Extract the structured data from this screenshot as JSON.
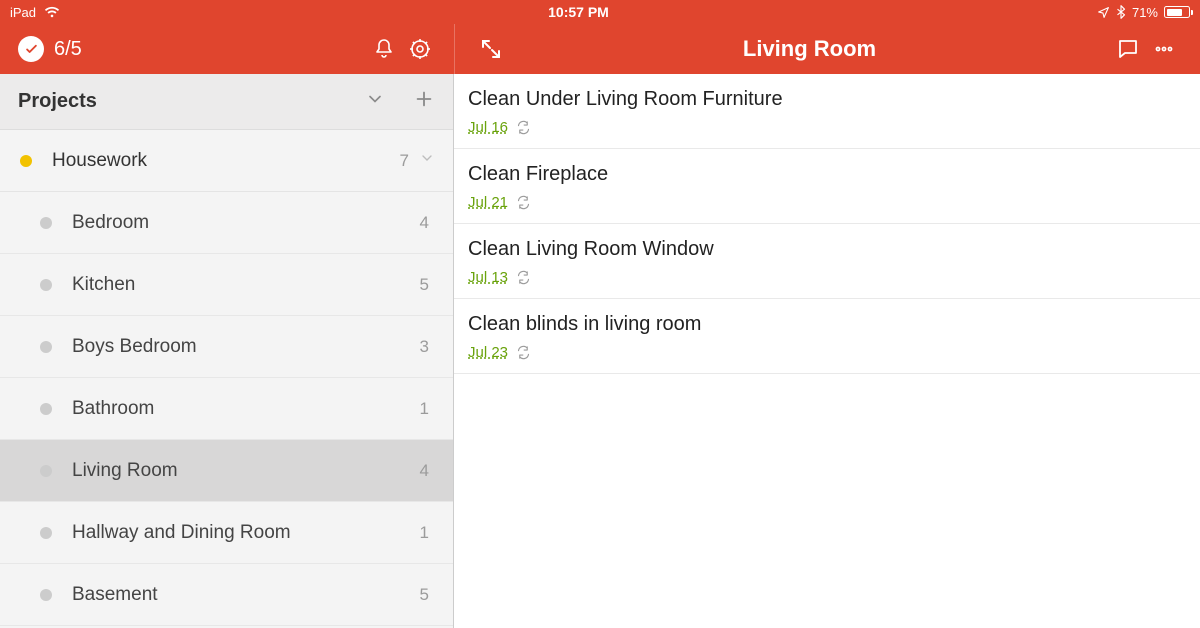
{
  "status": {
    "device": "iPad",
    "time": "10:57 PM",
    "battery_pct": "71%",
    "battery_level": 0.71
  },
  "appbar": {
    "date_label": "6/5",
    "content_title": "Living Room"
  },
  "sidebar": {
    "header": "Projects",
    "parent": {
      "name": "Housework",
      "count": "7"
    },
    "items": [
      {
        "name": "Bedroom",
        "count": "4"
      },
      {
        "name": "Kitchen",
        "count": "5"
      },
      {
        "name": "Boys Bedroom",
        "count": "3"
      },
      {
        "name": "Bathroom",
        "count": "1"
      },
      {
        "name": "Living Room",
        "count": "4"
      },
      {
        "name": "Hallway and Dining Room",
        "count": "1"
      },
      {
        "name": "Basement",
        "count": "5"
      }
    ],
    "selected_index": 4
  },
  "tasks": [
    {
      "title": "Clean Under Living Room Furniture",
      "date": "Jul 16"
    },
    {
      "title": "Clean Fireplace",
      "date": "Jul 21"
    },
    {
      "title": "Clean Living Room Window",
      "date": "Jul 13"
    },
    {
      "title": "Clean blinds in living room",
      "date": "Jul 23"
    }
  ]
}
